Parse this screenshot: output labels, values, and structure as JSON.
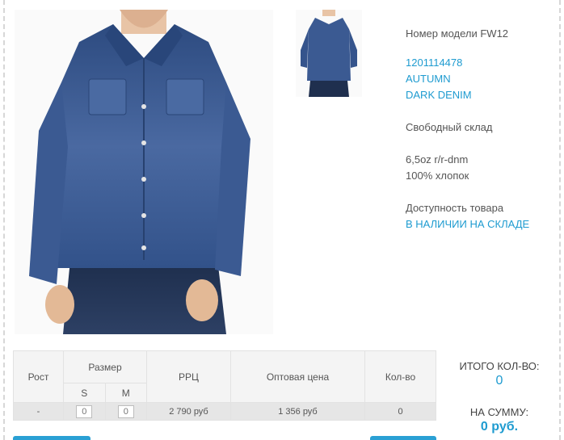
{
  "product": {
    "model": "Номер модели FW12",
    "code": "1201114478",
    "season": "AUTUMN",
    "color": "DARK DENIM",
    "warehouse": "Свободный склад",
    "fabric_line1": "6,5oz r/r-dnm",
    "fabric_line2": "100% хлопок",
    "availability_label": "Доступность товара",
    "availability_value": "В НАЛИЧИИ НА СКЛАДЕ"
  },
  "table": {
    "col_height": "Рост",
    "col_size": "Размер",
    "col_rrp": "РРЦ",
    "col_wholesale": "Оптовая цена",
    "col_qty": "Кол-во",
    "sizes": [
      "S",
      "M"
    ],
    "row": {
      "height": "-",
      "qty_s": "0",
      "qty_m": "0",
      "rrp": "2 790 руб",
      "wholesale": "1 356 руб",
      "qty": "0"
    }
  },
  "totals": {
    "qty_label": "ИТОГО КОЛ-ВО:",
    "qty_value": "0",
    "sum_label": "НА СУММУ:",
    "sum_value": "0 руб."
  },
  "colors": {
    "accent": "#1e9bd0",
    "denim": "#2f4f86"
  }
}
